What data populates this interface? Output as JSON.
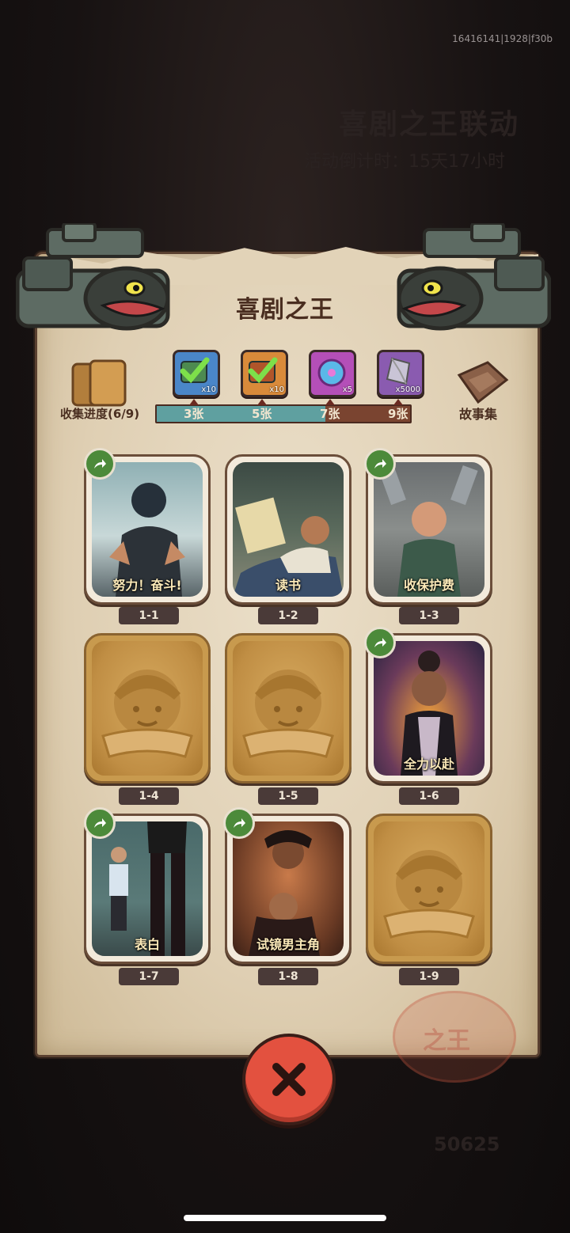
{
  "build_id": "16416141|1928|f30b",
  "background": {
    "title": "喜剧之王联动",
    "timer": "活动倒计时：15天17小时",
    "number": "50625"
  },
  "panel": {
    "title": "喜剧之王",
    "collect_label": "收集进度(6/9)",
    "story_label": "故事集"
  },
  "progress": {
    "collected": 6,
    "total": 9,
    "milestones": [
      {
        "label": "3张",
        "reward_qty": "x10",
        "reward_icon": "green-chest-icon",
        "claimed": true
      },
      {
        "label": "5张",
        "reward_qty": "x10",
        "reward_icon": "orange-chest-icon",
        "claimed": true
      },
      {
        "label": "7张",
        "reward_qty": "x5",
        "reward_icon": "purple-disc-icon",
        "claimed": false
      },
      {
        "label": "9张",
        "reward_qty": "x5000",
        "reward_icon": "crystal-icon",
        "claimed": false
      }
    ]
  },
  "cards": [
    {
      "id": "1-1",
      "name": "努力！奋斗!",
      "unlocked": true,
      "shareable": true
    },
    {
      "id": "1-2",
      "name": "读书",
      "unlocked": true,
      "shareable": false
    },
    {
      "id": "1-3",
      "name": "收保护费",
      "unlocked": true,
      "shareable": true
    },
    {
      "id": "1-4",
      "name": "",
      "unlocked": false,
      "shareable": false
    },
    {
      "id": "1-5",
      "name": "",
      "unlocked": false,
      "shareable": false
    },
    {
      "id": "1-6",
      "name": "全力以赴",
      "unlocked": true,
      "shareable": true
    },
    {
      "id": "1-7",
      "name": "表白",
      "unlocked": true,
      "shareable": true
    },
    {
      "id": "1-8",
      "name": "试镜男主角",
      "unlocked": true,
      "shareable": true
    },
    {
      "id": "1-9",
      "name": "",
      "unlocked": false,
      "shareable": false
    }
  ],
  "colors": {
    "parchment": "#e2d3b8",
    "progress_fill": "#5fa0a0",
    "progress_track": "#7a4430",
    "share_badge": "#4c8a3a",
    "close_button": "#e3513f"
  }
}
